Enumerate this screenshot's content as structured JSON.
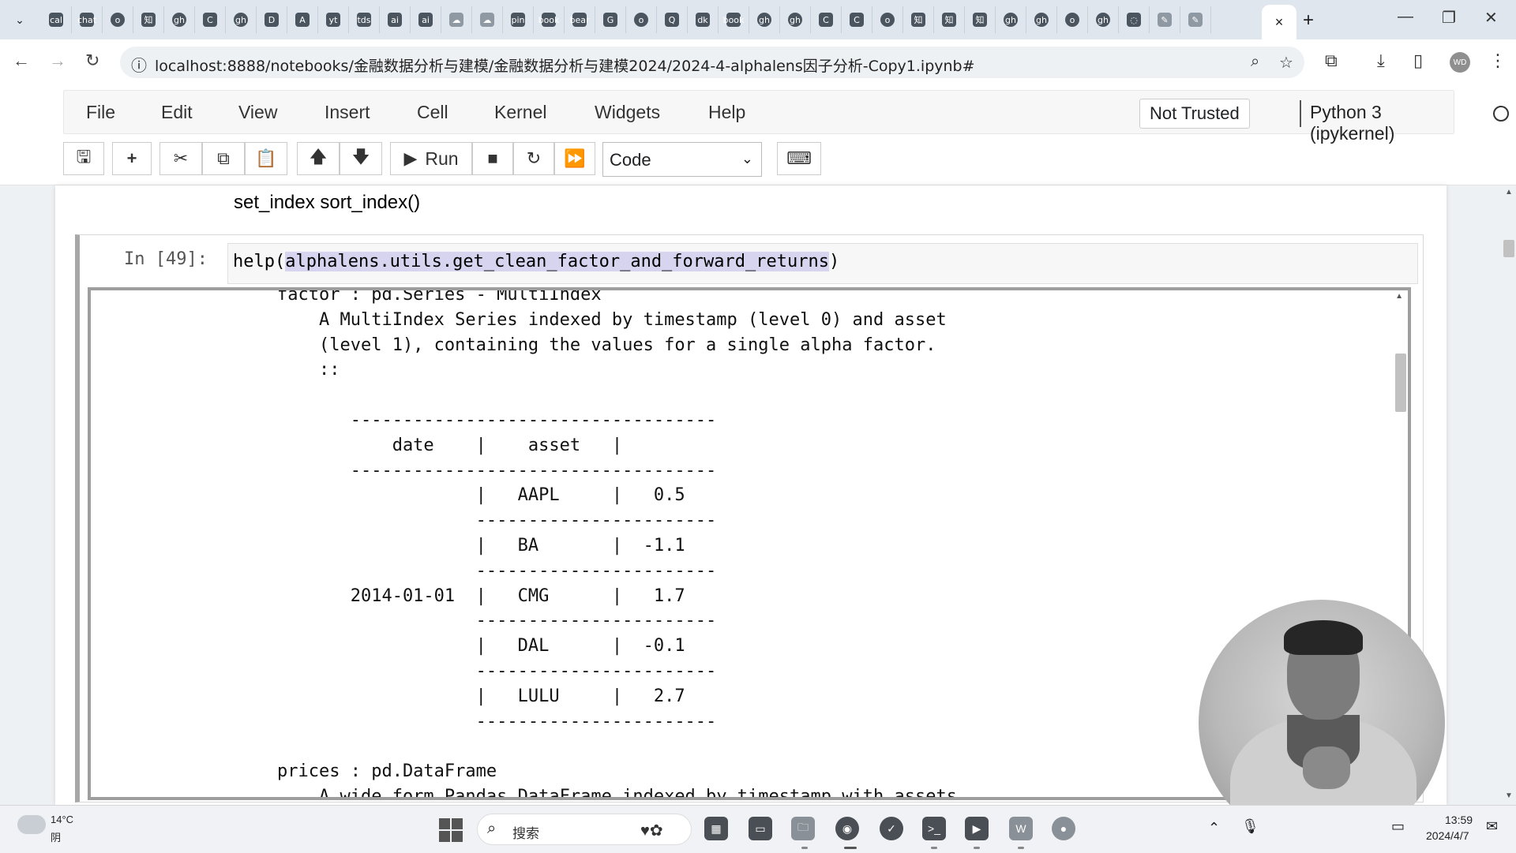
{
  "browser": {
    "url": "localhost:8888/notebooks/金融数据分析与建模/金融数据分析与建模2024/2024-4-alphalens因子分析-Copy1.ipynb#",
    "tab_favicons": [
      "cal",
      "chat",
      "o",
      "知",
      "gh",
      "C",
      "gh",
      "D",
      "A",
      "yt",
      "tds",
      "ai",
      "ai",
      "☁",
      "☁",
      "pin",
      "book",
      "bear",
      "G",
      "o",
      "Q",
      "dk",
      "book",
      "gh",
      "gh",
      "C",
      "C",
      "o",
      "知",
      "知",
      "知",
      "gh",
      "gh",
      "o",
      "gh",
      "◌",
      "✎",
      "✎"
    ],
    "active_tab_close": "×",
    "profile_initials": "WD"
  },
  "jupyter": {
    "menu": [
      "File",
      "Edit",
      "View",
      "Insert",
      "Cell",
      "Kernel",
      "Widgets",
      "Help"
    ],
    "trust_status": "Not Trusted",
    "kernel_name": "Python 3 (ipykernel)",
    "toolbar": {
      "run_label": "Run",
      "cell_type": "Code"
    }
  },
  "notebook": {
    "markdown_text": "set_index sort_index()",
    "cell": {
      "prompt": "In  [49]:",
      "code_prefix": "help(",
      "code_selected": "alphalens.utils.get_clean_factor_and_forward_returns",
      "code_suffix": ")",
      "output": "factor : pd.Series - MultiIndex\n    A MultiIndex Series indexed by timestamp (level 0) and asset\n    (level 1), containing the values for a single alpha factor.\n    ::\n\n       -----------------------------------\n           date    |    asset   |\n       -----------------------------------\n                   |   AAPL     |   0.5\n                   -----------------------\n                   |   BA       |  -1.1\n                   -----------------------\n       2014-01-01  |   CMG      |   1.7\n                   -----------------------\n                   |   DAL      |  -0.1\n                   -----------------------\n                   |   LULU     |   2.7\n                   -----------------------\n\nprices : pd.DataFrame\n    A wide form Pandas DataFrame indexed by timestamp with assets"
    }
  },
  "taskbar": {
    "weather_temp": "14°C",
    "weather_condition": "阴",
    "search_label": "搜索",
    "time": "13:59",
    "date": "2024/4/7"
  }
}
